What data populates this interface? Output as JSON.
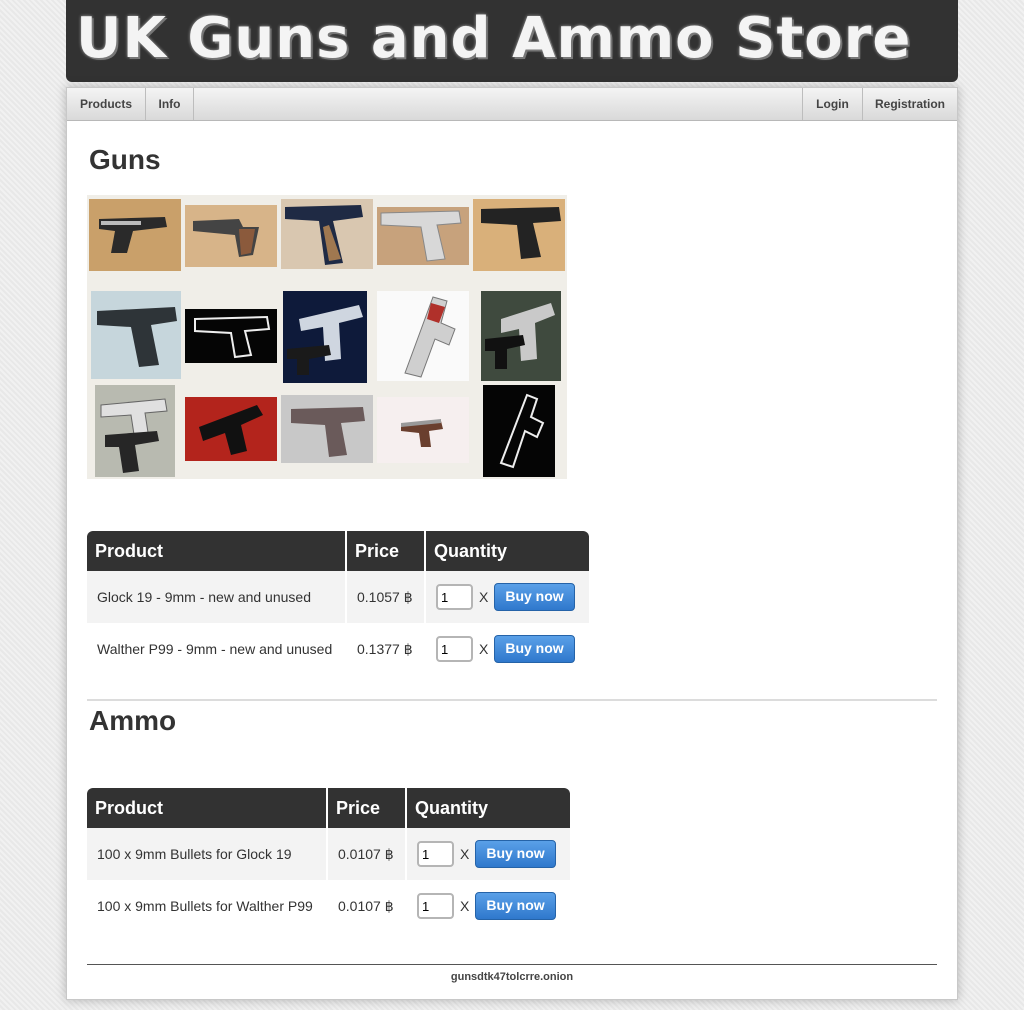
{
  "banner": {
    "title": "UK Guns and Ammo Store"
  },
  "nav": {
    "left": [
      "Products",
      "Info"
    ],
    "right": [
      "Login",
      "Registration"
    ]
  },
  "guns": {
    "title": "Guns",
    "table": {
      "headers": [
        "Product",
        "Price",
        "Quantity"
      ],
      "rows": [
        {
          "name": "Glock 19 - 9mm - new and unused",
          "price": "0.1057 ฿",
          "qty": "1",
          "multiply": "X",
          "button": "Buy now"
        },
        {
          "name": "Walther P99 - 9mm - new and unused",
          "price": "0.1377 ฿",
          "qty": "1",
          "multiply": "X",
          "button": "Buy now"
        }
      ]
    }
  },
  "ammo": {
    "title": "Ammo",
    "table": {
      "headers": [
        "Product",
        "Price",
        "Quantity"
      ],
      "rows": [
        {
          "name": "100 x 9mm Bullets for Glock 19",
          "price": "0.0107 ฿",
          "qty": "1",
          "multiply": "X",
          "button": "Buy now"
        },
        {
          "name": "100 x 9mm Bullets for Walther P99",
          "price": "0.0107 ฿",
          "qty": "1",
          "multiply": "X",
          "button": "Buy now"
        }
      ]
    }
  },
  "footer": {
    "text": "gunsdtk47tolcrre.onion"
  },
  "colors": {
    "banner_bg": "#323232",
    "button_blue": "#2f78cc",
    "table_header": "#323232"
  }
}
